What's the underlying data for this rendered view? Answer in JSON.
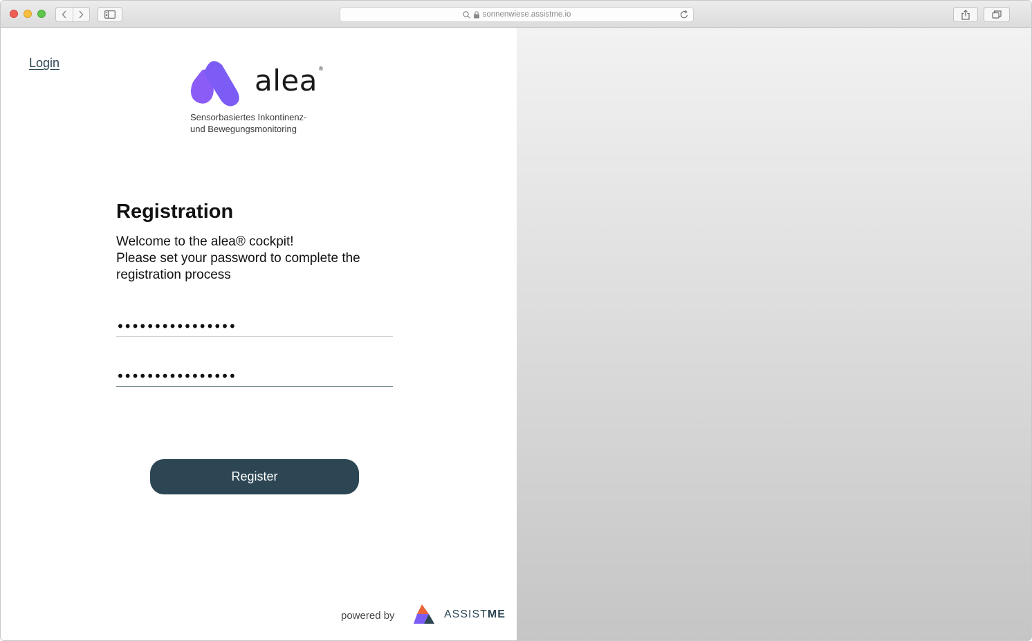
{
  "browser": {
    "url": "sonnenwiese.assistme.io"
  },
  "nav": {
    "login_label": "Login"
  },
  "brand": {
    "name": "alea",
    "registered_mark": "®",
    "tagline_line1": "Sensorbasiertes Inkontinenz-",
    "tagline_line2": "und Bewegungsmonitoring",
    "colors": {
      "accent": "#7b5cf5",
      "primary": "#2c4654"
    }
  },
  "registration": {
    "title": "Registration",
    "welcome_line1": "Welcome to the alea® cockpit!",
    "welcome_line2": "Please set your password to complete the registration process",
    "password_value": "••••••••••••••••",
    "password_confirm_value": "••••••••••••••••",
    "submit_label": "Register"
  },
  "footer": {
    "powered_by": "powered by",
    "partner_name_light": "ASSIST",
    "partner_name_bold": "ME"
  }
}
